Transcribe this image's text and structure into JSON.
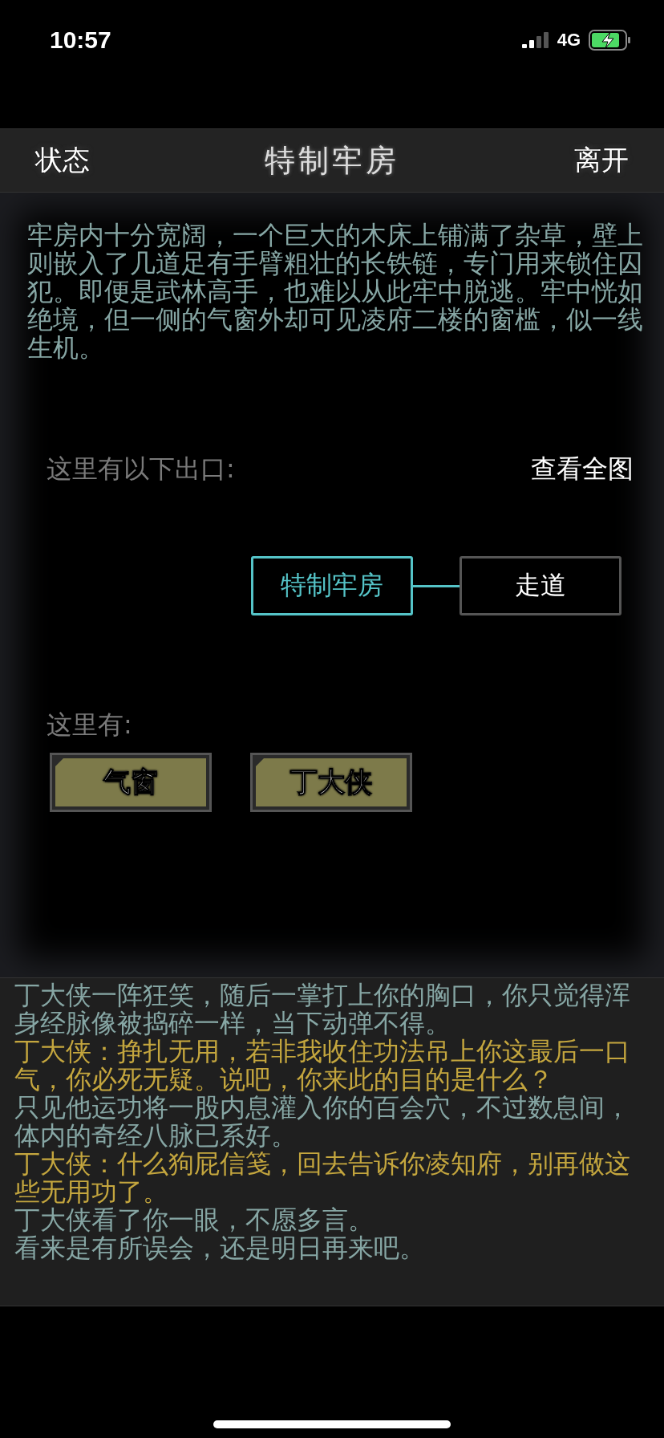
{
  "status_bar": {
    "time": "10:57",
    "network": "4G",
    "charging": true
  },
  "header": {
    "left": "状态",
    "title": "特制牢房",
    "right": "离开"
  },
  "description": "牢房内十分宽阔，一个巨大的木床上铺满了杂草，壁上则嵌入了几道足有手臂粗壮的长铁链，专门用来锁住囚犯。即便是武林高手，也难以从此牢中脱逃。牢中恍如绝境，但一侧的气窗外却可见凌府二楼的窗槛，似一线生机。",
  "exits": {
    "label": "这里有以下出口:",
    "map_link": "查看全图",
    "nodes": [
      {
        "name": "特制牢房",
        "current": true
      },
      {
        "name": "走道",
        "current": false
      }
    ]
  },
  "here": {
    "label": "这里有:",
    "items": [
      "气窗",
      "丁大侠"
    ]
  },
  "log": [
    {
      "kind": "narration",
      "text": "丁大侠一阵狂笑，随后一掌打上你的胸口，你只觉得浑身经脉像被捣碎一样，当下动弹不得。"
    },
    {
      "kind": "dialogue",
      "text": "丁大侠：挣扎无用，若非我收住功法吊上你这最后一口气，你必死无疑。说吧，你来此的目的是什么？"
    },
    {
      "kind": "narration",
      "text": "只见他运功将一股内息灌入你的百会穴，不过数息间，体内的奇经八脉已系好。"
    },
    {
      "kind": "dialogue",
      "text": "丁大侠：什么狗屁信笺，回去告诉你凌知府，别再做这些无用功了。"
    },
    {
      "kind": "narration",
      "text": "丁大侠看了你一眼，不愿多言。"
    },
    {
      "kind": "narration",
      "text": "看来是有所误会，还是明日再来吧。"
    }
  ]
}
